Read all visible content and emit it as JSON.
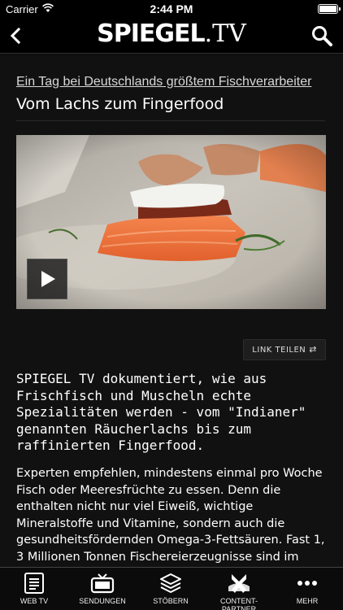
{
  "status": {
    "carrier": "Carrier",
    "time": "2:44 PM"
  },
  "nav": {
    "logo_main": "SPIEGEL",
    "logo_suffix": ".TV"
  },
  "article": {
    "kicker": "Ein Tag bei Deutschlands größtem Fischverarbeiter",
    "headline": "Vom Lachs zum Fingerfood",
    "share_label": "LINK TEILEN",
    "lead": "SPIEGEL TV dokumentiert, wie aus Frischfisch und Muscheln echte Spezialitäten werden - vom \"Indianer\" genannten Räucherlachs bis zum raffinierten Fingerfood.",
    "body": "Experten empfehlen, mindestens einmal pro Woche Fisch oder Meeresfrüchte zu essen. Denn die enthalten nicht nur viel Eiweiß, wichtige Mineralstoffe und Vitamine, sondern auch die gesundheitsfördernden Omega-3-Fettsäuren. Fast 1, 3 Millionen Tonnen Fischereierzeugnisse sind im"
  },
  "tabs": [
    {
      "label": "WEB TV",
      "icon": "document-icon"
    },
    {
      "label": "SENDUNGEN",
      "icon": "tv-icon"
    },
    {
      "label": "STÖBERN",
      "icon": "layers-icon"
    },
    {
      "label": "CONTENT-PARTNER",
      "icon": "partner-icon"
    },
    {
      "label": "MEHR",
      "icon": "more-dots-icon"
    }
  ]
}
